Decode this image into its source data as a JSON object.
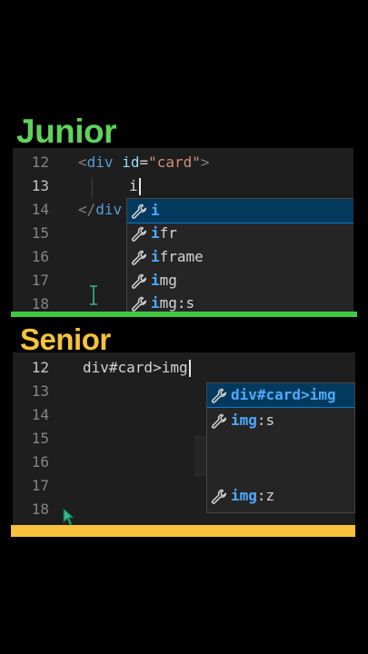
{
  "colors": {
    "junior_heading": "#5fd35a",
    "senior_heading": "#f6c33a",
    "green_bar": "#43c844",
    "yellow_bar": "#f7c23a",
    "editor_bg": "#1e1e1e",
    "suggest_selected_bg": "#04395e"
  },
  "junior": {
    "heading": "Junior",
    "lines": [
      {
        "num": "12",
        "tokens": [
          {
            "t": "<",
            "c": "t-punc"
          },
          {
            "t": "div",
            "c": "t-tag"
          },
          {
            "t": " ",
            "c": "t-plain"
          },
          {
            "t": "id",
            "c": "t-attr"
          },
          {
            "t": "=",
            "c": "t-plain"
          },
          {
            "t": "\"card\"",
            "c": "t-str"
          },
          {
            "t": ">",
            "c": "t-punc"
          }
        ]
      },
      {
        "num": "13",
        "typed": "i",
        "active": true
      },
      {
        "num": "14",
        "tokens": [
          {
            "t": "</",
            "c": "t-punc"
          },
          {
            "t": "div",
            "c": "t-tag"
          }
        ]
      },
      {
        "num": "15"
      },
      {
        "num": "16"
      },
      {
        "num": "17"
      },
      {
        "num": "18"
      }
    ],
    "suggestions": [
      {
        "match": "i",
        "rest": "",
        "selected": true
      },
      {
        "match": "i",
        "rest": "fr"
      },
      {
        "match": "i",
        "rest": "frame"
      },
      {
        "match": "i",
        "rest": "mg"
      },
      {
        "match": "i",
        "rest": "mg:s"
      }
    ],
    "suggest_icon": "wrench-icon"
  },
  "senior": {
    "heading": "Senior",
    "lines": [
      {
        "num": "12",
        "text": "div#card>img",
        "active": true
      },
      {
        "num": "13"
      },
      {
        "num": "14"
      },
      {
        "num": "15"
      },
      {
        "num": "16"
      },
      {
        "num": "17"
      },
      {
        "num": "18"
      }
    ],
    "suggestions": [
      {
        "match": "div#card>img",
        "rest": "",
        "selected": true
      },
      {
        "match": "img",
        "rest": ":s"
      },
      {
        "match": "img",
        "rest": ":z"
      }
    ],
    "suggest_icon": "wrench-icon"
  }
}
